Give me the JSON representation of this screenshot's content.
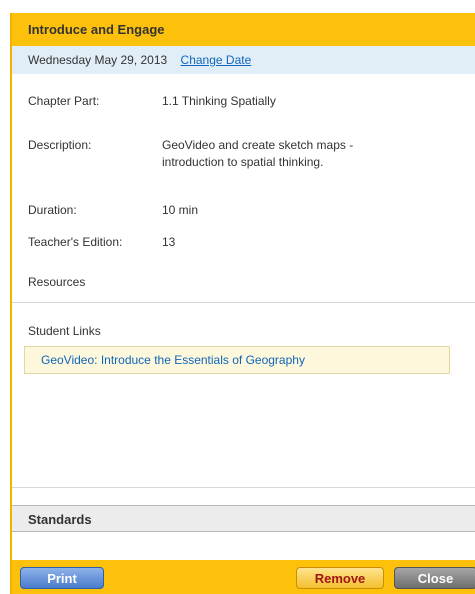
{
  "header": {
    "title": "Introduce and Engage"
  },
  "date_bar": {
    "date": "Wednesday May 29, 2013",
    "change_link": "Change Date"
  },
  "details": {
    "chapter_part_label": "Chapter Part:",
    "chapter_part_value": "1.1  Thinking Spatially",
    "description_label": "Description:",
    "description_value": "GeoVideo and create sketch maps - introduction to spatial thinking.",
    "duration_label": "Duration:",
    "duration_value": "10 min",
    "teachers_edition_label": "Teacher's Edition:",
    "teachers_edition_value": "13"
  },
  "resources": {
    "heading": "Resources",
    "student_links_label": "Student Links",
    "links": [
      "GeoVideo: Introduce the Essentials of Geography"
    ]
  },
  "standards": {
    "heading": "Standards"
  },
  "footer": {
    "print_label": "Print",
    "remove_label": "Remove",
    "close_label": "Close"
  },
  "colors": {
    "accent": "#fdc10c",
    "date_bar": "#e1eef8",
    "link": "#1166bb",
    "print_button": "#4a7ccc",
    "remove_text": "#a31515",
    "close_button": "#6e6e6e"
  }
}
